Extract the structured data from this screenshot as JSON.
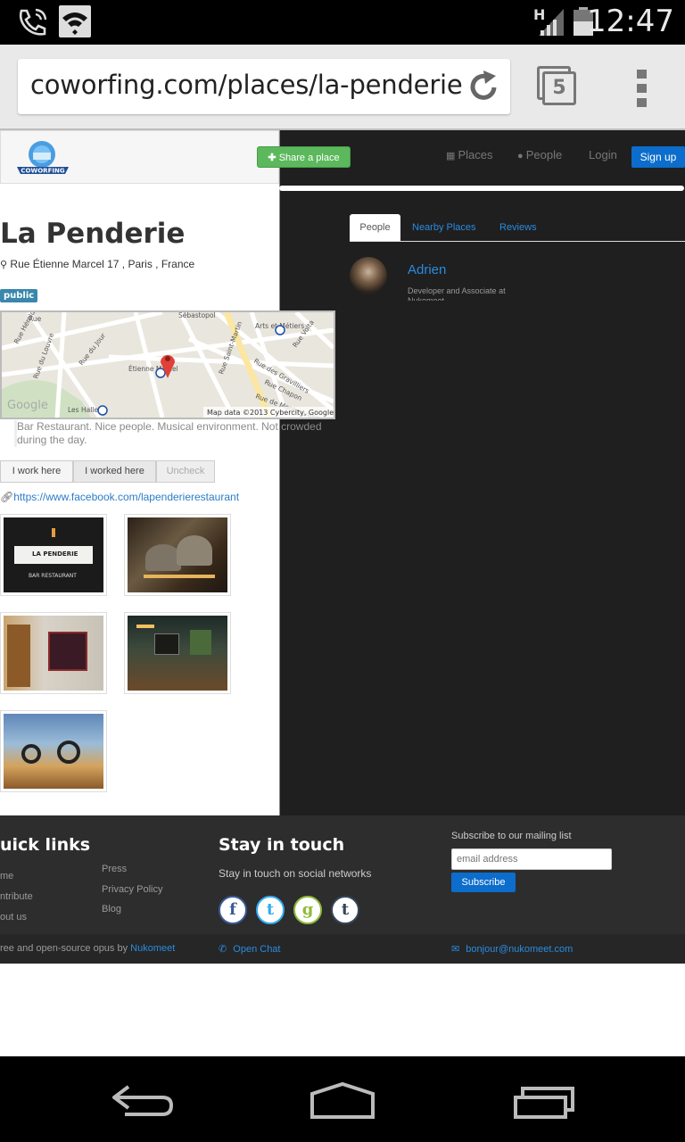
{
  "status_bar": {
    "time": "12:47",
    "network": "H"
  },
  "browser": {
    "url": "coworfing.com/places/la-penderie",
    "tab_count": "5"
  },
  "navbar": {
    "share_label": "Share a place",
    "places_label": "Places",
    "people_label": "People",
    "login_label": "Login",
    "signup_label": "Sign up",
    "logo_text": "COWORFING"
  },
  "place": {
    "title": "La Penderie",
    "address": "Rue Étienne Marcel 17 , Paris , France",
    "badge": "public",
    "description": "Bar Restaurant. Nice people. Musical environment. Not crowded during the day.",
    "website": "https://www.facebook.com/lapenderierestaurant"
  },
  "map": {
    "attribution": "Map data ©2013 Cybercity, Google",
    "google": "Google",
    "streets": [
      "Rue Hérold",
      "Rue du Louvre",
      "Rue du Jour",
      "Étienne Marcel",
      "Les Halles",
      "Arts et Métiers",
      "Rue Volta",
      "Rue des Gravilliers",
      "Rue Chapon",
      "Rue de Montmorency",
      "Sébastopol",
      "Rue Saint-Martin",
      "Rue"
    ]
  },
  "actions": {
    "work_here": "I work here",
    "worked_here": "I worked here",
    "uncheck": "Uncheck"
  },
  "tabs": {
    "people": "People",
    "nearby": "Nearby Places",
    "reviews": "Reviews"
  },
  "person": {
    "name": "Adrien",
    "role": "Developer and Associate at",
    "company": "Nukomeet"
  },
  "photos": [
    {
      "caption": "LA PENDERIE",
      "subcaption": "BAR RESTAURANT"
    }
  ],
  "footer": {
    "quick_links_title": "uick links",
    "quick_links": [
      "me",
      "ntribute",
      "out us"
    ],
    "quick_links_2": [
      "Press",
      "Privacy Policy",
      "Blog"
    ],
    "stay_title": "Stay in touch",
    "stay_text": "Stay in touch on social networks",
    "subscribe_label": "Subscribe to our mailing list",
    "email_placeholder": "email address",
    "subscribe_button": "Subscribe",
    "credit_prefix": "ree and open-source opus by",
    "credit_link": "Nukomeet",
    "open_chat": "Open Chat",
    "email": "bonjour@nukomeet.com",
    "social": [
      "f",
      "t",
      "g",
      "t"
    ]
  },
  "colors": {
    "accent": "#0c6dcc",
    "share_green": "#5cb85c",
    "badge": "#3a87ad",
    "dark_panel": "#1f1f1f",
    "footer": "#2d2d2d"
  }
}
